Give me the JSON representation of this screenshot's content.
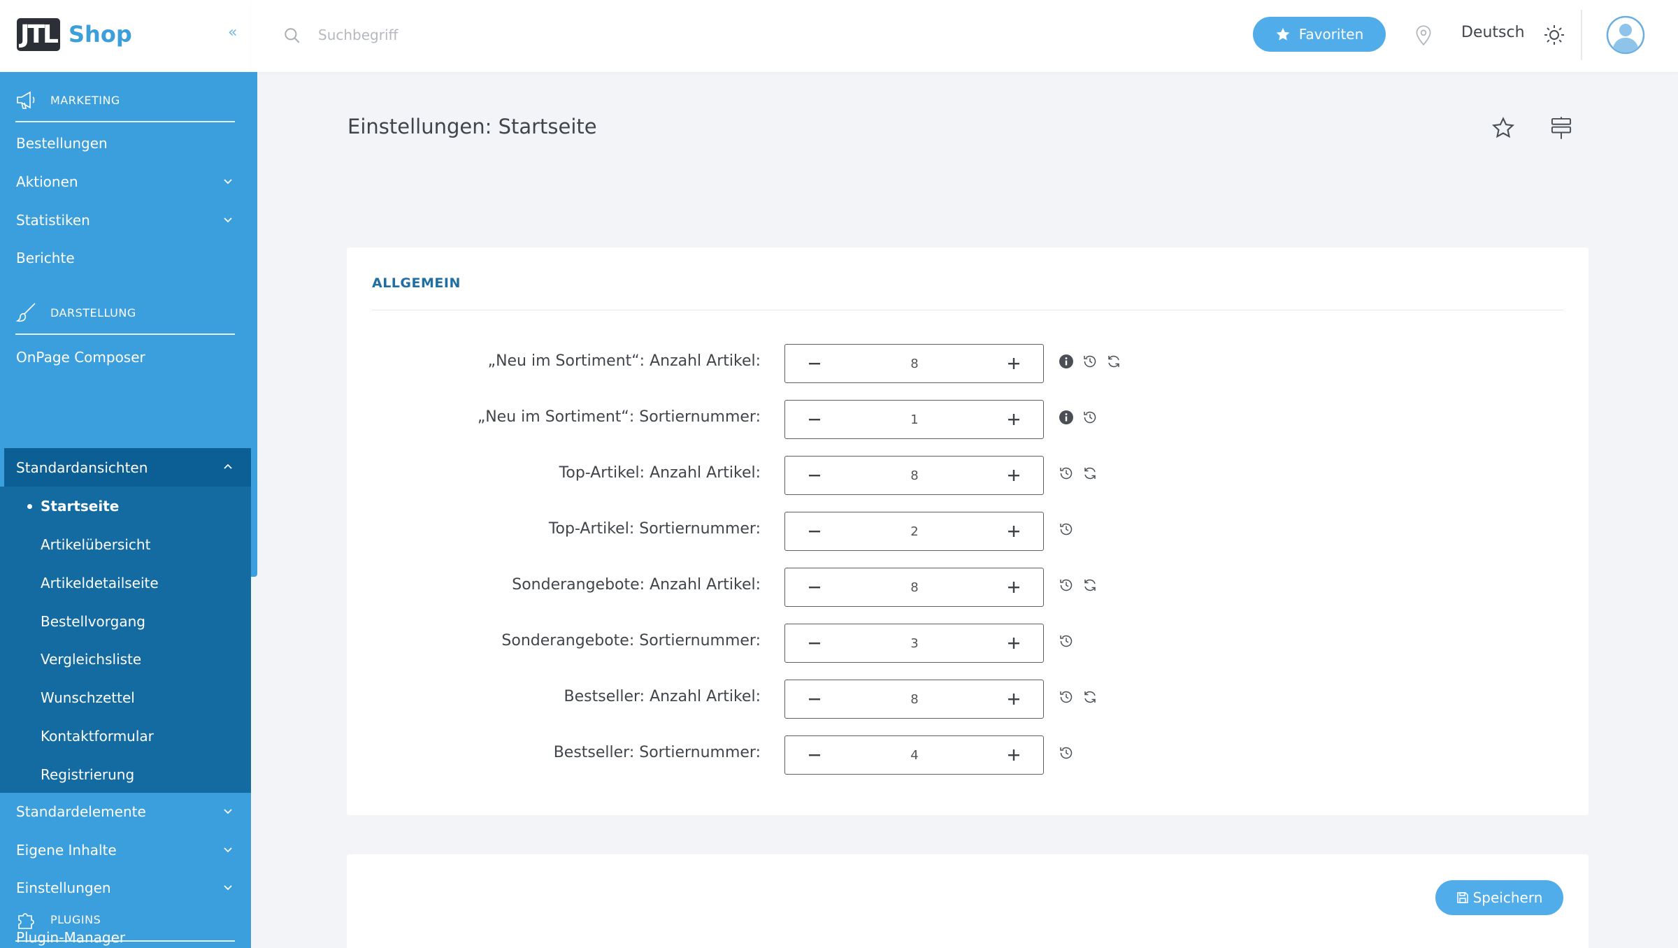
{
  "app": {
    "logo_mark": "JTL",
    "logo_text": "Shop",
    "collapse_glyph": "«"
  },
  "header": {
    "search_placeholder": "Suchbegriff",
    "favorites_label": "Favoriten",
    "language": "Deutsch"
  },
  "sidebar": {
    "marketing": {
      "title": "MARKETING",
      "items": [
        "Bestellungen",
        "Aktionen",
        "Statistiken",
        "Berichte"
      ]
    },
    "darstellung": {
      "title": "DARSTELLUNG",
      "items": [
        "OnPage Composer",
        "Standardansichten"
      ],
      "subitems": [
        "Startseite",
        "Artikelübersicht",
        "Artikeldetailseite",
        "Bestellvorgang",
        "Vergleichsliste",
        "Wunschzettel",
        "Kontaktformular",
        "Registrierung"
      ],
      "after": [
        "Standardelemente",
        "Eigene Inhalte",
        "Einstellungen"
      ]
    },
    "plugins": {
      "title": "PLUGINS",
      "items": [
        "Plugin-Manager"
      ]
    },
    "active_item": "Startseite"
  },
  "main": {
    "title": "Einstellungen: Startseite",
    "section_title": "ALLGEMEIN",
    "rows": [
      {
        "label": "„Neu im Sortiment“: Anzahl Artikel:",
        "value": "8"
      },
      {
        "label": "„Neu im Sortiment“: Sortiernummer:",
        "value": "1"
      },
      {
        "label": "Top-Artikel: Anzahl Artikel:",
        "value": "8"
      },
      {
        "label": "Top-Artikel: Sortiernummer:",
        "value": "2"
      },
      {
        "label": "Sonderangebote: Anzahl Artikel:",
        "value": "8"
      },
      {
        "label": "Sonderangebote: Sortiernummer:",
        "value": "3"
      },
      {
        "label": "Bestseller: Anzahl Artikel:",
        "value": "8"
      },
      {
        "label": "Bestseller: Sortiernummer:",
        "value": "4"
      }
    ],
    "save_label": "Speichern"
  },
  "colors": {
    "accent": "#50adea",
    "sidebar": "#3c9fdd",
    "sidebar_group": "#136ba2",
    "section_title": "#1f6fa4"
  }
}
